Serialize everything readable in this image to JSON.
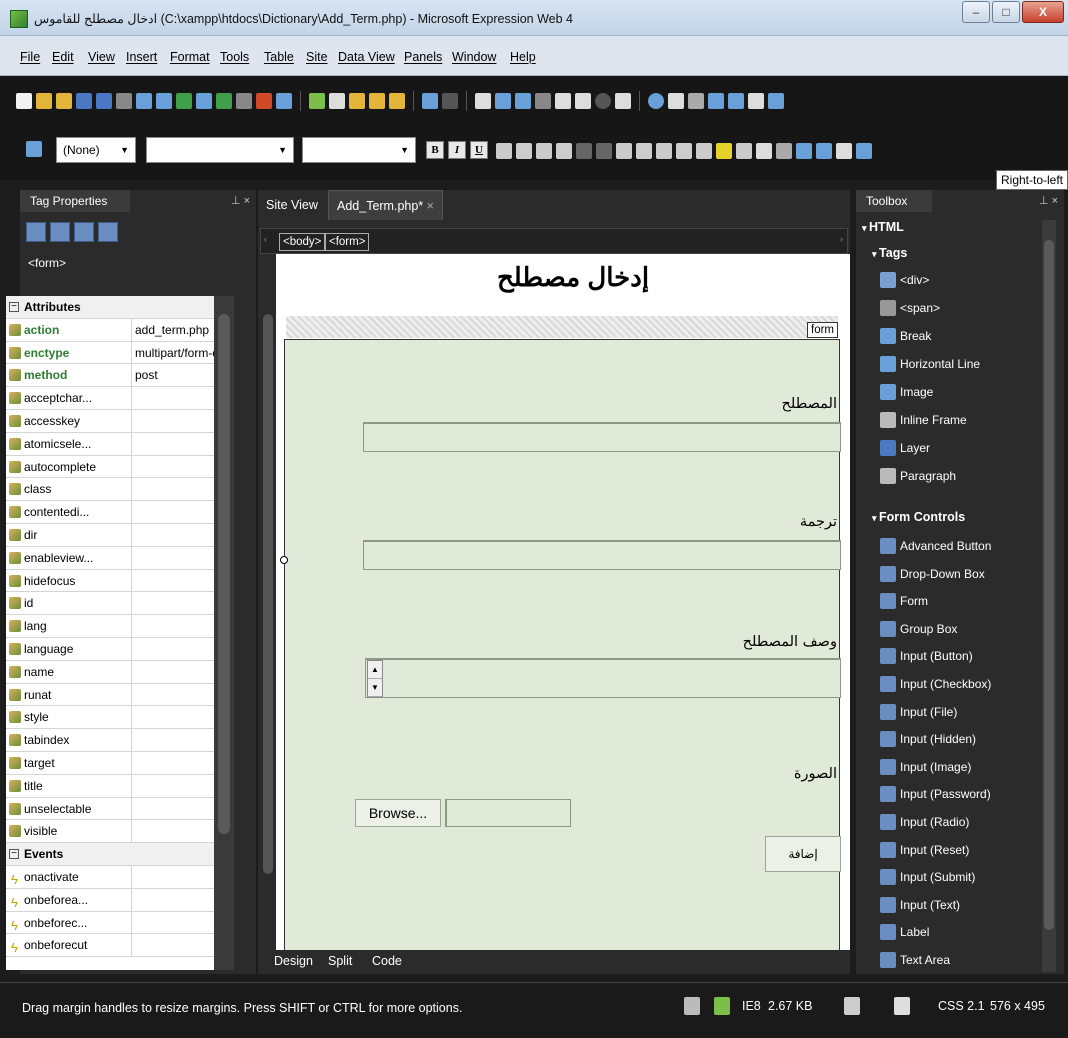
{
  "window": {
    "title": "ادخال مصطلح للقاموس (C:\\xampp\\htdocs\\Dictionary\\Add_Term.php) - Microsoft Expression Web 4",
    "minimize": "–",
    "maximize": "□",
    "close": "X"
  },
  "menu": [
    "File",
    "Edit",
    "View",
    "Insert",
    "Format",
    "Tools",
    "Table",
    "Site",
    "Data View",
    "Panels",
    "Window",
    "Help"
  ],
  "format_toolbar": {
    "style_value": "(None)",
    "font_value": "",
    "size_value": "",
    "buttons": [
      "B",
      "I",
      "U"
    ]
  },
  "tooltip": "Right-to-left",
  "tag_properties": {
    "title": "Tag Properties",
    "current_tag": "<form>",
    "attributes_header": "Attributes",
    "attributes": [
      {
        "name": "action",
        "value": "add_term.php",
        "set": true
      },
      {
        "name": "enctype",
        "value": "multipart/form-data",
        "set": true
      },
      {
        "name": "method",
        "value": "post",
        "set": true
      },
      {
        "name": "acceptchar...",
        "value": "",
        "set": false
      },
      {
        "name": "accesskey",
        "value": "",
        "set": false
      },
      {
        "name": "atomicsele...",
        "value": "",
        "set": false
      },
      {
        "name": "autocomplete",
        "value": "",
        "set": false
      },
      {
        "name": "class",
        "value": "",
        "set": false
      },
      {
        "name": "contentedi...",
        "value": "",
        "set": false
      },
      {
        "name": "dir",
        "value": "",
        "set": false
      },
      {
        "name": "enableview...",
        "value": "",
        "set": false
      },
      {
        "name": "hidefocus",
        "value": "",
        "set": false
      },
      {
        "name": "id",
        "value": "",
        "set": false
      },
      {
        "name": "lang",
        "value": "",
        "set": false
      },
      {
        "name": "language",
        "value": "",
        "set": false
      },
      {
        "name": "name",
        "value": "",
        "set": false
      },
      {
        "name": "runat",
        "value": "",
        "set": false
      },
      {
        "name": "style",
        "value": "",
        "set": false
      },
      {
        "name": "tabindex",
        "value": "",
        "set": false
      },
      {
        "name": "target",
        "value": "",
        "set": false
      },
      {
        "name": "title",
        "value": "",
        "set": false
      },
      {
        "name": "unselectable",
        "value": "",
        "set": false
      },
      {
        "name": "visible",
        "value": "",
        "set": false
      }
    ],
    "events_header": "Events",
    "events": [
      "onactivate",
      "onbeforea...",
      "onbeforec...",
      "onbeforecut"
    ]
  },
  "editor": {
    "tabs": [
      "Site View",
      "Add_Term.php*"
    ],
    "quick_tags": [
      "<body>",
      "<form>"
    ],
    "heading": "إدخال مصطلح",
    "form_tag_label": "form",
    "fields": {
      "term_label": "المصطلح",
      "translation_label": "ترجمة",
      "description_label": "وصف المصطلح",
      "image_label": "الصورة",
      "browse_button": "Browse...",
      "submit_button": "إضافة"
    },
    "view_tabs": [
      "Design",
      "Split",
      "Code"
    ]
  },
  "toolbox": {
    "title": "Toolbox",
    "section_html": "HTML",
    "group_tags": "Tags",
    "tags": [
      "<div>",
      "<span>",
      "Break",
      "Horizontal Line",
      "Image",
      "Inline Frame",
      "Layer",
      "Paragraph"
    ],
    "group_forms": "Form Controls",
    "form_controls": [
      "Advanced Button",
      "Drop-Down Box",
      "Form",
      "Group Box",
      "Input (Button)",
      "Input (Checkbox)",
      "Input (File)",
      "Input (Hidden)",
      "Input (Image)",
      "Input (Password)",
      "Input (Radio)",
      "Input (Reset)",
      "Input (Submit)",
      "Input (Text)",
      "Label",
      "Text Area"
    ]
  },
  "status": {
    "message": "Drag margin handles to resize margins. Press SHIFT or CTRL for more options.",
    "browser": "IE8",
    "size": "2.67 KB",
    "css": "CSS 2.1",
    "dimensions": "576 x 495"
  }
}
